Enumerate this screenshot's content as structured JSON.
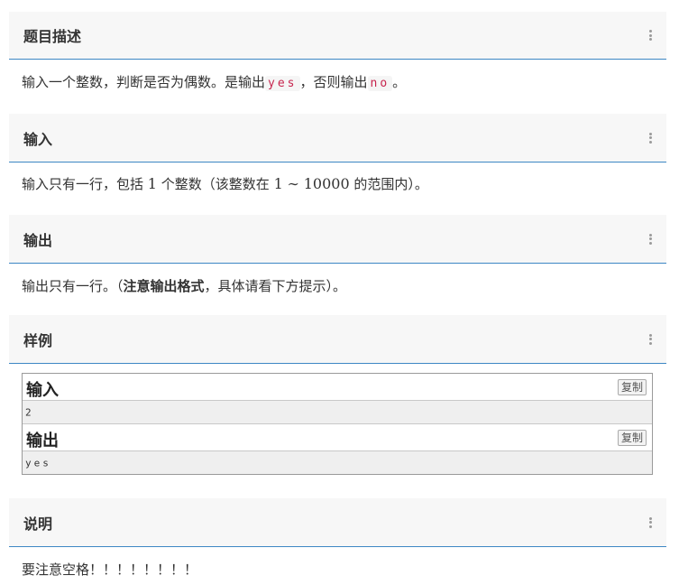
{
  "sections": {
    "description": {
      "title": "题目描述",
      "text_before": "输入一个整数，判断是否为偶数。是输出",
      "code_yes": "yes",
      "text_middle": "，否则输出",
      "code_no": "no",
      "text_after": "。"
    },
    "input": {
      "title": "输入",
      "text_before": "输入只有一行，包括",
      "num_one": "1",
      "text_mid1": "个整数（该整数在",
      "range_start": "1",
      "tilde": "∼",
      "range_end": "10000",
      "text_after": "的范围内）。"
    },
    "output": {
      "title": "输出",
      "text_before": "输出只有一行。（",
      "bold_text": "注意输出格式",
      "text_after": "，具体请看下方提示）。"
    },
    "sample": {
      "title": "样例",
      "input_title": "输入",
      "input_copy": "复制",
      "input_value": "2",
      "output_title": "输出",
      "output_copy": "复制",
      "output_value": "yes"
    },
    "note": {
      "title": "说明",
      "text": "要注意空格！！！！！！！！"
    }
  },
  "colors": {
    "accent_border": "#3d87c4",
    "header_bg": "#f7f7f7",
    "code_red": "#c7254e"
  },
  "icons": {
    "section_menu": "kebab-menu-icon"
  }
}
